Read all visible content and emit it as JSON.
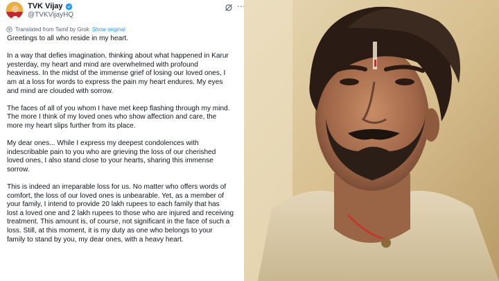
{
  "tweet": {
    "author_name": "TVK Vijay",
    "handle": "@TVKVijayHQ",
    "translated_from": "Translated from Tamil by Grok",
    "show_original": "Show original",
    "paragraphs": [
      " Greetings to all who reside in my heart.",
      "In a way that defies imagination, thinking about what happened in Karur\nyesterday, my heart and mind are overwhelmed with profound\nheaviness. In the midst of the immense grief of losing our loved ones, I\nam at a loss for words to express the pain my heart endures. My eyes\nand mind are clouded with sorrow.",
      "The faces of all of you whom I have met keep flashing through my mind.\nThe more I think of my loved ones who show affection and care, the\nmore my heart slips further from its place.",
      "My dear ones... While I express my deepest condolences with\nindescribable pain to you who are grieving the loss of our cherished\nloved ones, I also stand close to your hearts, sharing this immense\nsorrow.",
      "This is indeed an irreparable loss for us. No matter who offers words of\ncomfort, the loss of our loved ones is unbearable. Yet, as a member of\nyour family, I intend to provide 20 lakh rupees to each family that has\nlost a loved one and 2 lakh rupees to those who are injured and receiving\ntreatment. This amount is, of course, not significant in the face of such a\nloss. Still, at this moment, it is my duty as one who belongs to your\nfamily to stand by you, my dear ones, with a heavy heart."
    ]
  },
  "icons": {
    "verified": "verified-badge-icon",
    "grok": "grok-icon",
    "more": "more-icon",
    "translate": "translate-icon"
  },
  "colors": {
    "accent": "#1d9bf0",
    "text": "#0f1419",
    "muted": "#536471"
  }
}
